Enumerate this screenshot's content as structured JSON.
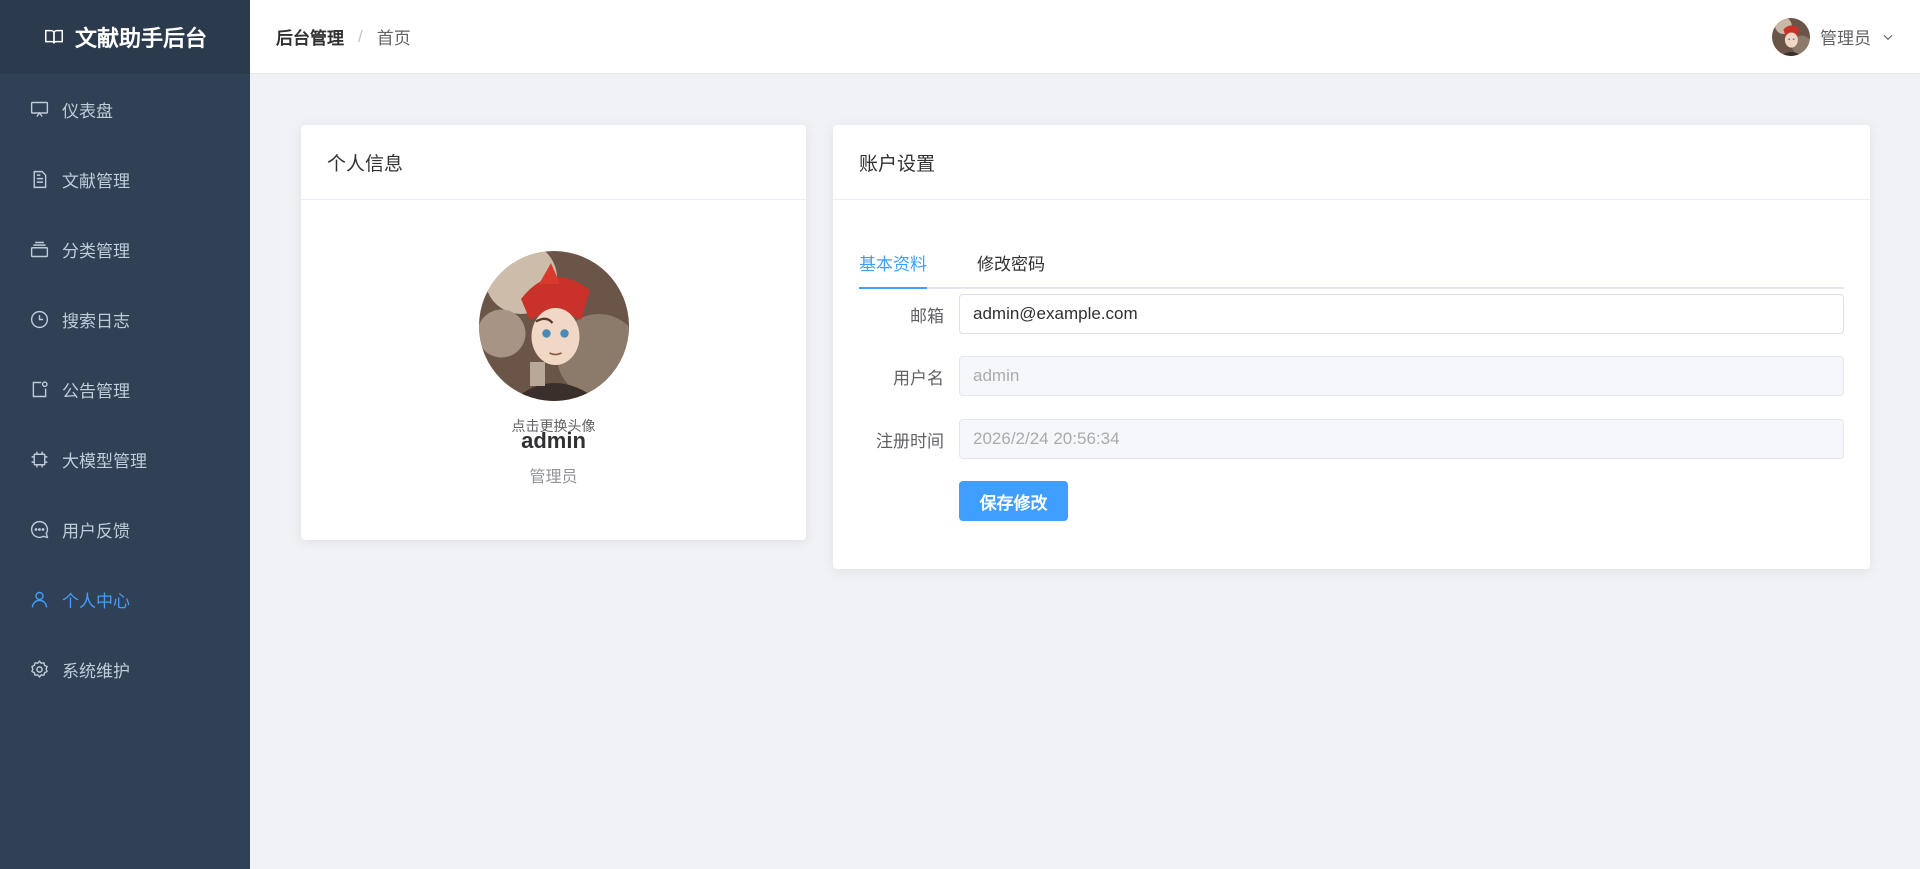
{
  "brand": {
    "title": "文献助手后台",
    "icon": "book-icon"
  },
  "sidebar": {
    "items": [
      {
        "label": "仪表盘",
        "icon": "dashboard-icon",
        "active": false
      },
      {
        "label": "文献管理",
        "icon": "document-icon",
        "active": false
      },
      {
        "label": "分类管理",
        "icon": "category-icon",
        "active": false
      },
      {
        "label": "搜索日志",
        "icon": "clock-icon",
        "active": false
      },
      {
        "label": "公告管理",
        "icon": "notice-icon",
        "active": false
      },
      {
        "label": "大模型管理",
        "icon": "chip-icon",
        "active": false
      },
      {
        "label": "用户反馈",
        "icon": "chat-icon",
        "active": false
      },
      {
        "label": "个人中心",
        "icon": "user-icon",
        "active": true
      },
      {
        "label": "系统维护",
        "icon": "gear-icon",
        "active": false
      }
    ]
  },
  "header": {
    "breadcrumb": {
      "root": "后台管理",
      "separator": "/",
      "current": "首页"
    },
    "user": {
      "name": "管理员",
      "dropdown_icon": "chevron-down-icon"
    }
  },
  "profile": {
    "title": "个人信息",
    "change_avatar_hint": "点击更换头像",
    "username": "admin",
    "role": "管理员"
  },
  "account": {
    "title": "账户设置",
    "tabs": [
      {
        "label": "基本资料",
        "active": true
      },
      {
        "label": "修改密码",
        "active": false
      }
    ],
    "form": {
      "email_label": "邮箱",
      "email_value": "admin@example.com",
      "username_label": "用户名",
      "username_value": "admin",
      "register_time_label": "注册时间",
      "register_time_value": "2026/2/24 20:56:34"
    },
    "save_label": "保存修改"
  },
  "colors": {
    "sidebar_bg": "#304156",
    "sidebar_text": "#bfcbd9",
    "accent": "#409eff",
    "page_bg": "#f0f2f5"
  }
}
